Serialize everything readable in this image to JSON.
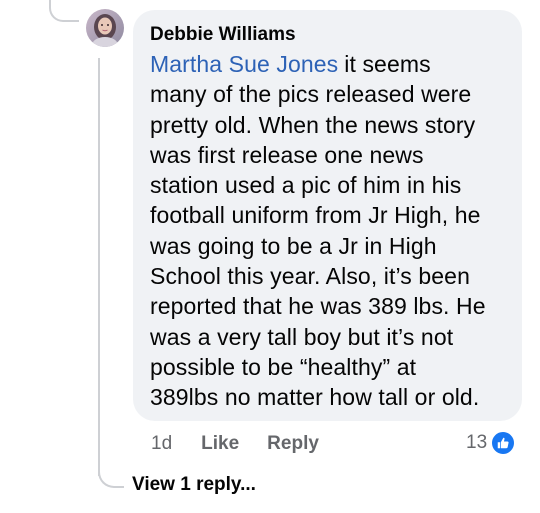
{
  "comment": {
    "author": "Debbie Williams",
    "mention": "Martha Sue Jones",
    "lines": [
      "it seems",
      "many of the pics released were",
      "pretty old. When the news story",
      "was first release one news",
      "station used a pic of him in his",
      "football uniform from Jr High, he",
      "was going to be a Jr in High",
      "School this year. Also, it’s been",
      "reported that he was 389 lbs. He",
      "was a very tall boy but it’s not",
      "possible to be “healthy” at",
      "389lbs no matter how tall or old."
    ],
    "timestamp": "1d",
    "like_label": "Like",
    "reply_label": "Reply",
    "reaction_count": "13",
    "reaction_icon": "thumbs-up-icon",
    "reaction_color": "#1877f2",
    "mention_color": "#2d62b6"
  },
  "replies": {
    "view_label": "View 1 reply..."
  }
}
